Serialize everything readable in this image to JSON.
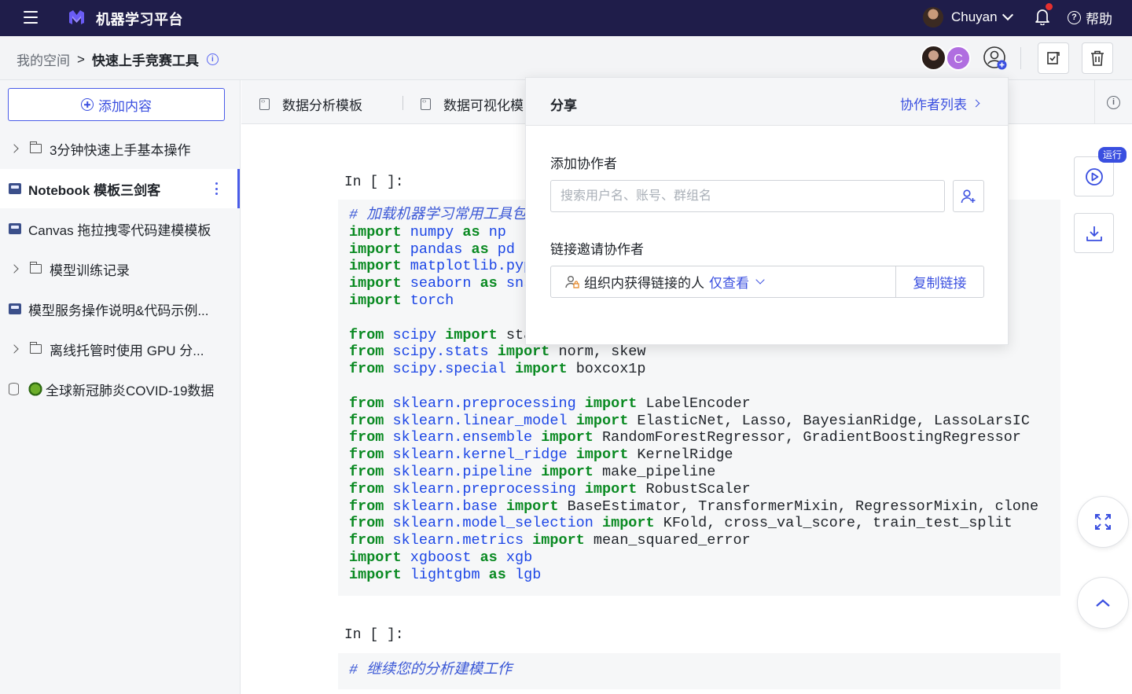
{
  "topbar": {
    "app_title": "机器学习平台",
    "user_name": "Chuyan",
    "help_label": "帮助"
  },
  "breadcrumb": {
    "root": "我的空间",
    "separator": ">",
    "current": "快速上手竞赛工具"
  },
  "collaborators": {
    "avatar2_letter": "C"
  },
  "sidebar": {
    "add_label": "添加内容",
    "items": [
      {
        "label": "3分钟快速上手基本操作",
        "icon": "folder-icon",
        "expandable": true
      },
      {
        "label": "Notebook 模板三剑客",
        "icon": "notebook-icon",
        "active": true
      },
      {
        "label": "Canvas 拖拉拽零代码建模模板",
        "icon": "notebook-icon"
      },
      {
        "label": "模型训练记录",
        "icon": "folder-icon",
        "expandable": true
      },
      {
        "label": "模型服务操作说明&代码示例...",
        "icon": "notebook-icon"
      },
      {
        "label": "离线托管时使用 GPU 分...",
        "icon": "folder-icon",
        "expandable": true
      },
      {
        "label": "全球新冠肺炎COVID-19数据",
        "icon": "dataset-icon"
      }
    ]
  },
  "tabs": [
    {
      "label": "数据分析模板"
    },
    {
      "label": "数据可视化模"
    }
  ],
  "notebook": {
    "prompt1": "In [ ]:",
    "prompt2": "In [ ]:",
    "cell2_comment": "# 继续您的分析建模工作"
  },
  "floating": {
    "run_badge": "运行"
  },
  "share_popover": {
    "title": "分享",
    "collab_list_link": "协作者列表",
    "add_collab_label": "添加协作者",
    "search_placeholder": "搜索用户名、账号、群组名",
    "invite_label": "链接邀请协作者",
    "link_scope": "组织内获得链接的人",
    "link_permission": "仅查看",
    "copy_link": "复制链接"
  },
  "colors": {
    "topbar_bg": "#1f1d4a",
    "accent": "#3a4fe0",
    "keyword": "#0a8a22",
    "module": "#1c46e6"
  }
}
